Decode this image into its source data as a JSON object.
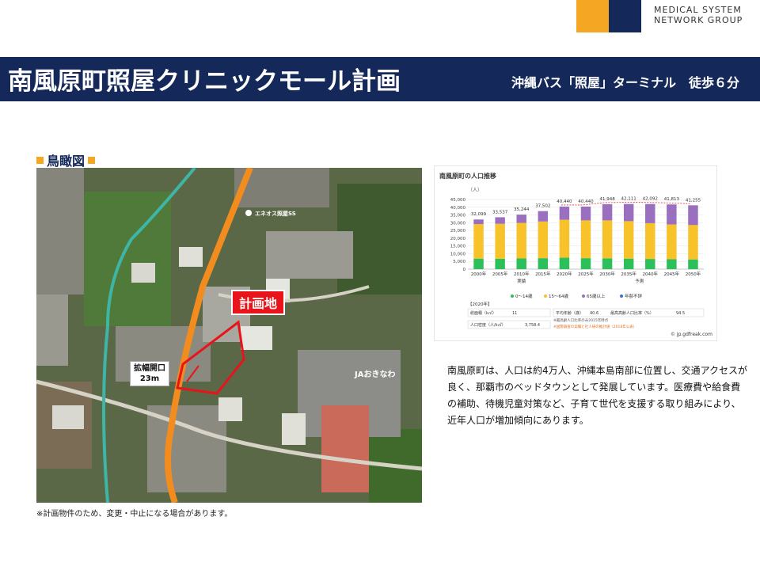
{
  "logo": {
    "line1": "MEDICAL SYSTEM",
    "line2": "NETWORK GROUP",
    "colors": [
      "#f5a623",
      "#14285a"
    ]
  },
  "header": {
    "title": "南風原町照屋クリニックモール計画",
    "subtitle": "沖縄バス「照屋」ターミナル　徒歩６分"
  },
  "aerial": {
    "section_title": "鳥瞰図",
    "plan_label": "計画地",
    "widen_line1": "拡幅開口",
    "widen_line2": "23m",
    "ja_label": "JAおきなわ",
    "eneos_label": "エネオス照屋SS",
    "note": "※計画物件のため、変更・中止になる場合があります。"
  },
  "description": "南風原町は、人口は約4万人、沖縄本島南部に位置し、交通アクセスが良く、那覇市のベッドタウンとして発展しています。医療費や給食費の補助、待機児童対策など、子育て世代を支援する取り組みにより、近年人口が増加傾向にあります。",
  "chart_data": {
    "type": "bar",
    "title": "南風原町の人口推移",
    "unit": "（人）",
    "categories": [
      "2000年",
      "2005年",
      "2010年",
      "2015年",
      "2020年",
      "2025年",
      "2030年",
      "2035年",
      "2040年",
      "2045年",
      "2050年"
    ],
    "totals": [
      32099,
      33537,
      35244,
      37502,
      40440,
      40440,
      41948,
      42111,
      42092,
      41813,
      41255
    ],
    "total_labels": [
      "32,099",
      "33,537",
      "35,244",
      "37,502",
      "40,440",
      "40,440",
      "41,948",
      "42,111",
      "42,092",
      "41,813",
      "41,255"
    ],
    "series": [
      {
        "name": "0〜14歳",
        "color": "#2dbf5a",
        "values": [
          6800,
          6700,
          6900,
          7100,
          7400,
          7100,
          7000,
          6800,
          6600,
          6400,
          6300
        ]
      },
      {
        "name": "15〜64歳",
        "color": "#f7c22a",
        "values": [
          22300,
          22600,
          23000,
          23700,
          24500,
          24400,
          24500,
          24200,
          23100,
          22500,
          22200
        ]
      },
      {
        "name": "65歳以上",
        "color": "#9b6fc0",
        "values": [
          3000,
          4237,
          5344,
          6702,
          8440,
          8940,
          10448,
          11111,
          12392,
          12913,
          12755
        ]
      },
      {
        "name": "年齢不詳",
        "color": "#3b6fd1",
        "values": [
          0,
          0,
          0,
          0,
          100,
          0,
          0,
          0,
          0,
          0,
          0
        ]
      }
    ],
    "yticks": [
      "45,000",
      "40,000",
      "35,000",
      "30,000",
      "25,000",
      "20,000",
      "15,000",
      "10,000",
      "5,000",
      "0"
    ],
    "ylim": [
      0,
      45000
    ],
    "group_labels": [
      "実績",
      "予測"
    ],
    "table_header": "【2020年】",
    "table": [
      [
        "総面積（k㎡）",
        "11",
        "平均年齢（歳）",
        "40.6",
        "最高高齢人口比率（%）",
        "94.5"
      ],
      [
        "人口密度（人/k㎡）",
        "3,758.4",
        "※最高齢人口比率のみ2015年時点",
        "",
        "",
        ""
      ]
    ],
    "footnote": "※国勢調査の実績と社人研の推計値（2018年公表）",
    "source": "© jp.gdfreak.com"
  }
}
